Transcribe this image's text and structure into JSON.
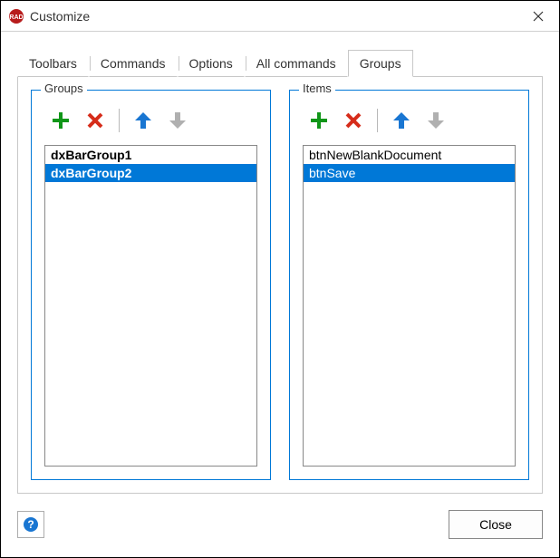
{
  "window": {
    "title": "Customize"
  },
  "tabs": {
    "toolbars": "Toolbars",
    "commands": "Commands",
    "options": "Options",
    "all_commands": "All commands",
    "groups": "Groups",
    "active": "groups"
  },
  "groups_panel": {
    "label": "Groups",
    "items": [
      {
        "text": "dxBarGroup1",
        "selected": false,
        "bold": true
      },
      {
        "text": "dxBarGroup2",
        "selected": true,
        "bold": true
      }
    ]
  },
  "items_panel": {
    "label": "Items",
    "items": [
      {
        "text": "btnNewBlankDocument",
        "selected": false,
        "bold": false
      },
      {
        "text": "btnSave",
        "selected": true,
        "bold": false
      }
    ]
  },
  "toolbar_buttons": {
    "add": "add",
    "delete": "delete",
    "move_up": "move-up",
    "move_down": "move-down"
  },
  "footer": {
    "close": "Close"
  },
  "colors": {
    "accent": "#0078d7",
    "green": "#109618",
    "red": "#d62c1a",
    "blue": "#1976d2",
    "gray": "#b0b0b0"
  }
}
